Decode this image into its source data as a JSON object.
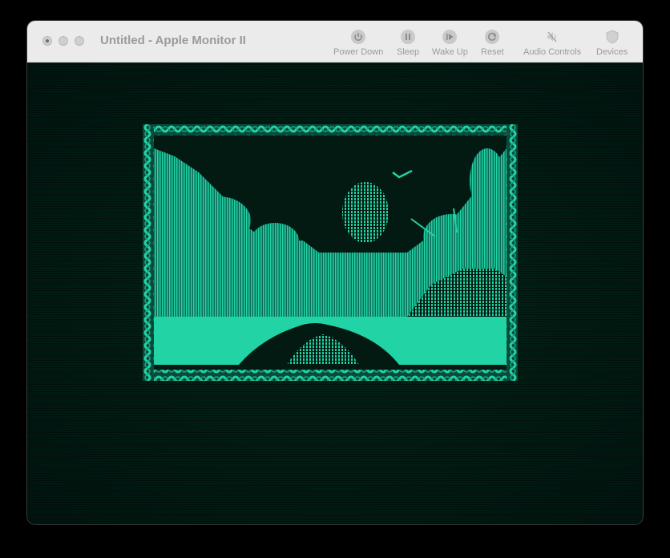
{
  "window": {
    "title": "Untitled - Apple Monitor II"
  },
  "toolbar": {
    "buttons": [
      {
        "label": "Power Down",
        "icon": "power-icon"
      },
      {
        "label": "Sleep",
        "icon": "pause-icon"
      },
      {
        "label": "Wake Up",
        "icon": "play-icon"
      },
      {
        "label": "Reset",
        "icon": "reset-icon"
      },
      {
        "label": "Audio Controls",
        "icon": "speaker-icon"
      },
      {
        "label": "Devices",
        "icon": "shield-icon"
      }
    ]
  },
  "colors": {
    "phosphor": "#22d3a6",
    "screen_bg": "#021a12",
    "titlebar": "#ebebeb"
  }
}
